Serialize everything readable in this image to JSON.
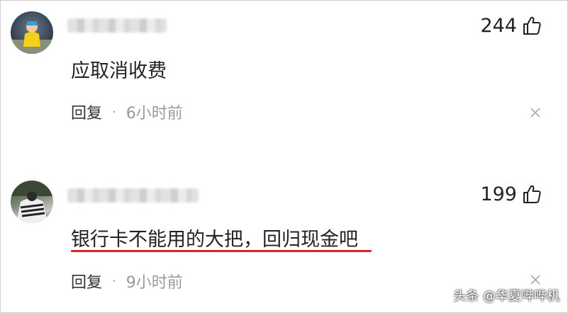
{
  "comments": [
    {
      "like_count": "244",
      "text": "应取消收费",
      "reply_label": "回复",
      "separator": "·",
      "time": "6小时前"
    },
    {
      "like_count": "199",
      "text": "银行卡不能用的大把，回归现金吧",
      "reply_label": "回复",
      "separator": "·",
      "time": "9小时前"
    }
  ],
  "watermark": "头条 @华夏哔哔机",
  "colors": {
    "underline": "#d9262b",
    "muted": "#999999"
  }
}
